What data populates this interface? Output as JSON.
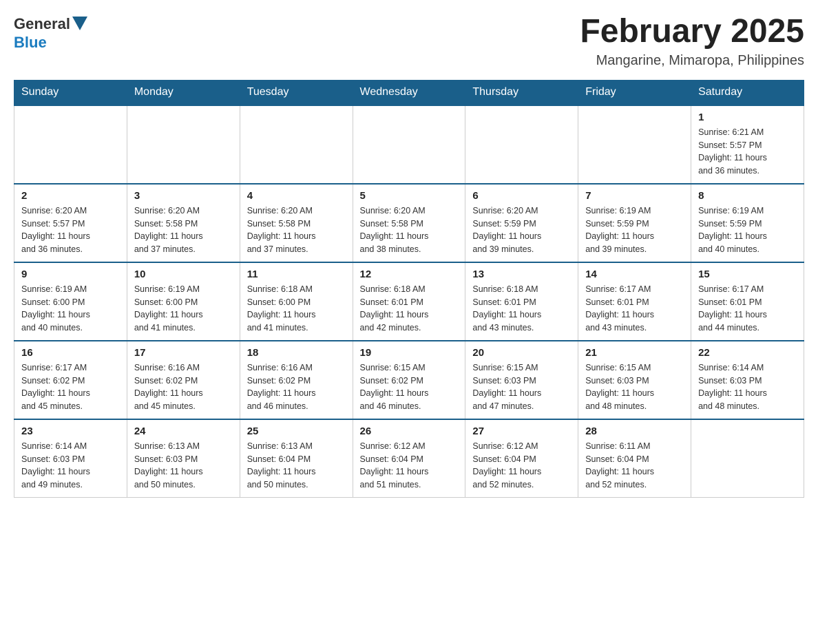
{
  "header": {
    "logo": {
      "general": "General",
      "arrow": "▶",
      "blue": "Blue"
    },
    "title": "February 2025",
    "location": "Mangarine, Mimaropa, Philippines"
  },
  "days_of_week": [
    "Sunday",
    "Monday",
    "Tuesday",
    "Wednesday",
    "Thursday",
    "Friday",
    "Saturday"
  ],
  "weeks": [
    [
      {
        "day": "",
        "info": ""
      },
      {
        "day": "",
        "info": ""
      },
      {
        "day": "",
        "info": ""
      },
      {
        "day": "",
        "info": ""
      },
      {
        "day": "",
        "info": ""
      },
      {
        "day": "",
        "info": ""
      },
      {
        "day": "1",
        "info": "Sunrise: 6:21 AM\nSunset: 5:57 PM\nDaylight: 11 hours\nand 36 minutes."
      }
    ],
    [
      {
        "day": "2",
        "info": "Sunrise: 6:20 AM\nSunset: 5:57 PM\nDaylight: 11 hours\nand 36 minutes."
      },
      {
        "day": "3",
        "info": "Sunrise: 6:20 AM\nSunset: 5:58 PM\nDaylight: 11 hours\nand 37 minutes."
      },
      {
        "day": "4",
        "info": "Sunrise: 6:20 AM\nSunset: 5:58 PM\nDaylight: 11 hours\nand 37 minutes."
      },
      {
        "day": "5",
        "info": "Sunrise: 6:20 AM\nSunset: 5:58 PM\nDaylight: 11 hours\nand 38 minutes."
      },
      {
        "day": "6",
        "info": "Sunrise: 6:20 AM\nSunset: 5:59 PM\nDaylight: 11 hours\nand 39 minutes."
      },
      {
        "day": "7",
        "info": "Sunrise: 6:19 AM\nSunset: 5:59 PM\nDaylight: 11 hours\nand 39 minutes."
      },
      {
        "day": "8",
        "info": "Sunrise: 6:19 AM\nSunset: 5:59 PM\nDaylight: 11 hours\nand 40 minutes."
      }
    ],
    [
      {
        "day": "9",
        "info": "Sunrise: 6:19 AM\nSunset: 6:00 PM\nDaylight: 11 hours\nand 40 minutes."
      },
      {
        "day": "10",
        "info": "Sunrise: 6:19 AM\nSunset: 6:00 PM\nDaylight: 11 hours\nand 41 minutes."
      },
      {
        "day": "11",
        "info": "Sunrise: 6:18 AM\nSunset: 6:00 PM\nDaylight: 11 hours\nand 41 minutes."
      },
      {
        "day": "12",
        "info": "Sunrise: 6:18 AM\nSunset: 6:01 PM\nDaylight: 11 hours\nand 42 minutes."
      },
      {
        "day": "13",
        "info": "Sunrise: 6:18 AM\nSunset: 6:01 PM\nDaylight: 11 hours\nand 43 minutes."
      },
      {
        "day": "14",
        "info": "Sunrise: 6:17 AM\nSunset: 6:01 PM\nDaylight: 11 hours\nand 43 minutes."
      },
      {
        "day": "15",
        "info": "Sunrise: 6:17 AM\nSunset: 6:01 PM\nDaylight: 11 hours\nand 44 minutes."
      }
    ],
    [
      {
        "day": "16",
        "info": "Sunrise: 6:17 AM\nSunset: 6:02 PM\nDaylight: 11 hours\nand 45 minutes."
      },
      {
        "day": "17",
        "info": "Sunrise: 6:16 AM\nSunset: 6:02 PM\nDaylight: 11 hours\nand 45 minutes."
      },
      {
        "day": "18",
        "info": "Sunrise: 6:16 AM\nSunset: 6:02 PM\nDaylight: 11 hours\nand 46 minutes."
      },
      {
        "day": "19",
        "info": "Sunrise: 6:15 AM\nSunset: 6:02 PM\nDaylight: 11 hours\nand 46 minutes."
      },
      {
        "day": "20",
        "info": "Sunrise: 6:15 AM\nSunset: 6:03 PM\nDaylight: 11 hours\nand 47 minutes."
      },
      {
        "day": "21",
        "info": "Sunrise: 6:15 AM\nSunset: 6:03 PM\nDaylight: 11 hours\nand 48 minutes."
      },
      {
        "day": "22",
        "info": "Sunrise: 6:14 AM\nSunset: 6:03 PM\nDaylight: 11 hours\nand 48 minutes."
      }
    ],
    [
      {
        "day": "23",
        "info": "Sunrise: 6:14 AM\nSunset: 6:03 PM\nDaylight: 11 hours\nand 49 minutes."
      },
      {
        "day": "24",
        "info": "Sunrise: 6:13 AM\nSunset: 6:03 PM\nDaylight: 11 hours\nand 50 minutes."
      },
      {
        "day": "25",
        "info": "Sunrise: 6:13 AM\nSunset: 6:04 PM\nDaylight: 11 hours\nand 50 minutes."
      },
      {
        "day": "26",
        "info": "Sunrise: 6:12 AM\nSunset: 6:04 PM\nDaylight: 11 hours\nand 51 minutes."
      },
      {
        "day": "27",
        "info": "Sunrise: 6:12 AM\nSunset: 6:04 PM\nDaylight: 11 hours\nand 52 minutes."
      },
      {
        "day": "28",
        "info": "Sunrise: 6:11 AM\nSunset: 6:04 PM\nDaylight: 11 hours\nand 52 minutes."
      },
      {
        "day": "",
        "info": ""
      }
    ]
  ]
}
